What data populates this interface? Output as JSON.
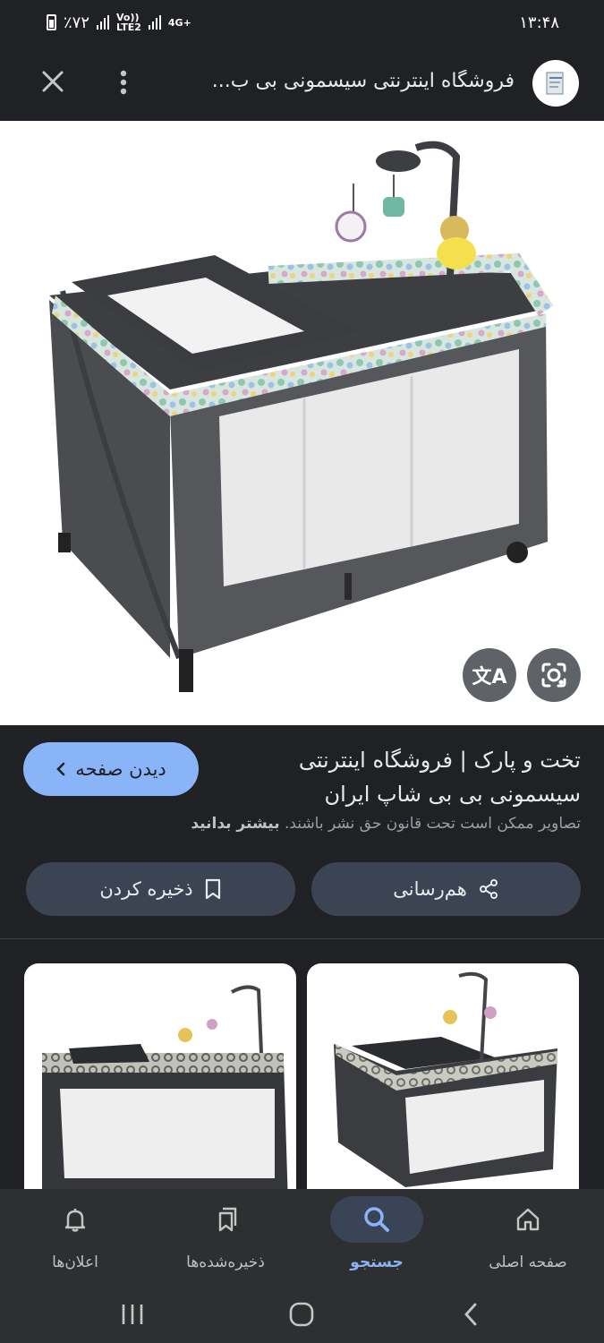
{
  "status_bar": {
    "time": "۱۳:۴۸",
    "battery": "٪۷۲",
    "network1": "Vo)) LTE2",
    "network2": "4G+"
  },
  "header": {
    "title": "فروشگاه اینترنتی سیسمونی بی ب...",
    "close_icon": "close-icon",
    "more_icon": "more-vertical-icon"
  },
  "hero": {
    "lens_icon": "google-lens-icon",
    "translate_icon": "translate-icon",
    "translate_glyph": "文A"
  },
  "details": {
    "title": "تخت و پارک | فروشگاه اینترنتی سیسمونی بی بی شاپ ایران",
    "visit_label": "دیدن صفحه",
    "copyright_text": "تصاویر ممکن است تحت قانون حق نشر باشند.",
    "learn_more": "بیشتر بدانید",
    "share_label": "هم‌رسانی",
    "save_label": "ذخیره کردن"
  },
  "bottom_nav": {
    "items": [
      {
        "label": "صفحه اصلی",
        "icon": "home-icon"
      },
      {
        "label": "جستجو",
        "icon": "search-icon",
        "active": true
      },
      {
        "label": "ذخیره‌شده‌ها",
        "icon": "bookmarks-icon"
      },
      {
        "label": "اعلان‌ها",
        "icon": "bell-icon"
      }
    ]
  },
  "colors": {
    "background": "#202124",
    "accent": "#8ab4f8",
    "button_bg": "#3c4454",
    "nav_bg": "#2d2f31"
  }
}
